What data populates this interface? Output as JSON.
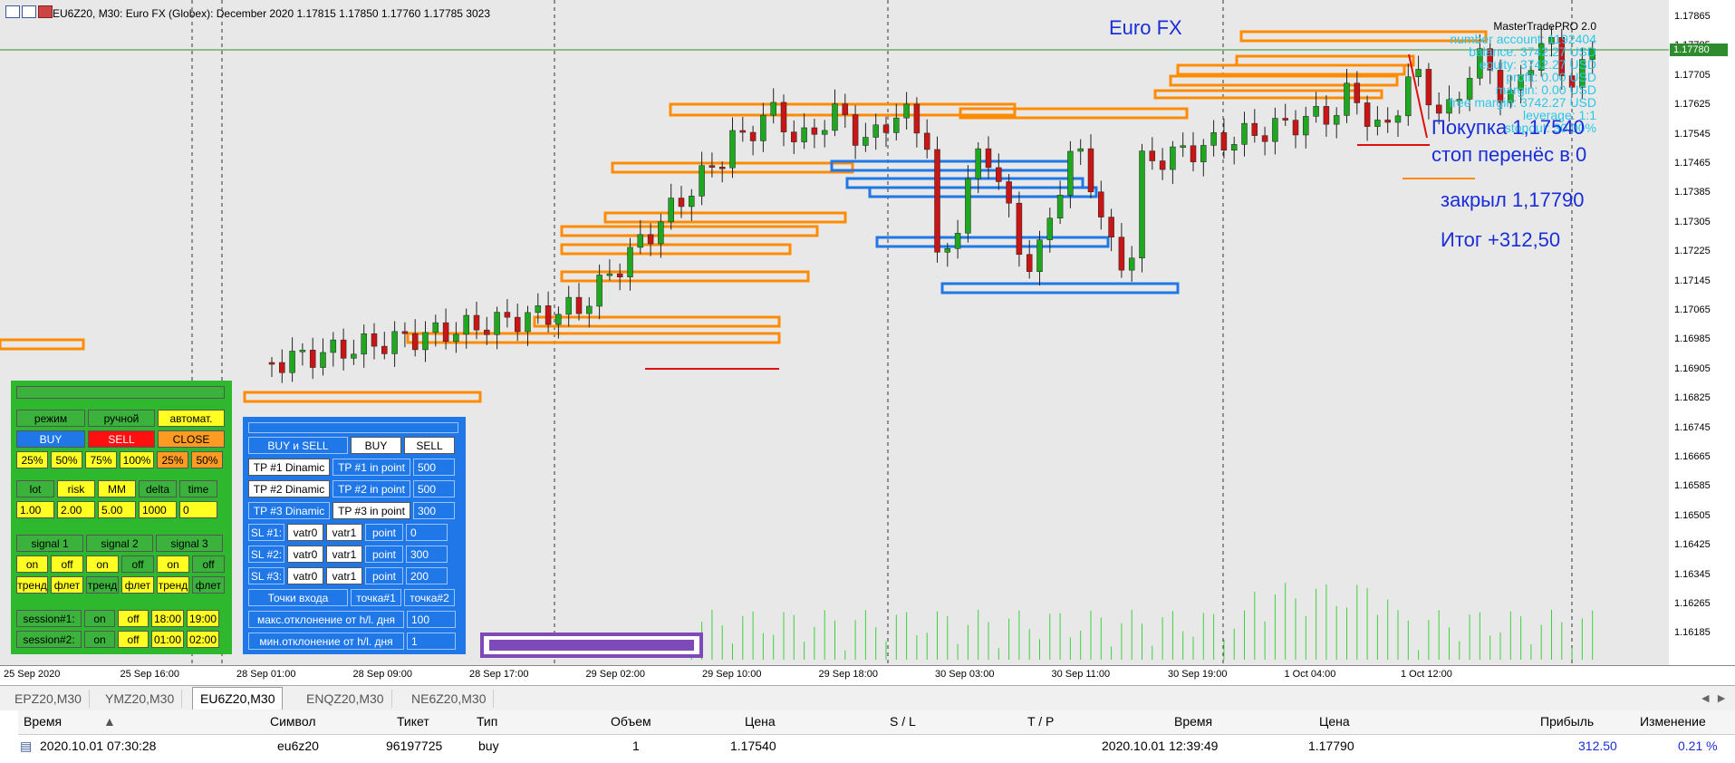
{
  "chart": {
    "title": "EU6Z20, M30:  Euro FX (Globex): December 2020  1.17815 1.17850 1.17760 1.17785  3023",
    "label_euro": "Euro FX",
    "current_price_tag": "1.17780",
    "price_ticks": [
      "1.17865",
      "1.17785",
      "1.17705",
      "1.17625",
      "1.17545",
      "1.17465",
      "1.17385",
      "1.17305",
      "1.17225",
      "1.17145",
      "1.17065",
      "1.16985",
      "1.16905",
      "1.16825",
      "1.16745",
      "1.16665",
      "1.16585",
      "1.16505",
      "1.16425",
      "1.16345",
      "1.16265",
      "1.16185"
    ],
    "time_ticks": [
      "25 Sep 2020",
      "25 Sep 16:00",
      "28 Sep 01:00",
      "28 Sep 09:00",
      "28 Sep 17:00",
      "29 Sep 02:00",
      "29 Sep 10:00",
      "29 Sep 18:00",
      "30 Sep 03:00",
      "30 Sep 11:00",
      "30 Sep 19:00",
      "1 Oct 04:00",
      "1 Oct 12:00"
    ],
    "colors": {
      "bull": "#1fa81f",
      "bear": "#c81515",
      "orange": "#ff8c00",
      "blue": "#1f77e8",
      "text_blue": "#1a2ed8",
      "cyan": "#2ac8e8"
    }
  },
  "account": {
    "brand": "MasterTradePRO 2.0",
    "lines": [
      "number account: 1192404",
      "balance: 3742.27 USD",
      "equity: 3742.27 USD",
      "profit: 0.00 USD",
      "margin: 0.00 USD",
      "free margin: 3742.27 USD",
      "leverage: 1:1",
      "stopout: 30.00%"
    ]
  },
  "annotations": {
    "buy": "Покупка 1,17540",
    "stop": "стоп перенёс в 0",
    "closed": "закрыл 1,17790",
    "result": "Итог +312,50"
  },
  "green_panel": {
    "mode": [
      "режим",
      "ручной",
      "автомат."
    ],
    "actions": [
      "BUY",
      "SELL",
      "CLOSE"
    ],
    "pct_left": [
      "25%",
      "50%",
      "75%",
      "100%"
    ],
    "pct_right": [
      "25%",
      "50%"
    ],
    "params_labels": [
      "lot",
      "risk",
      "MM",
      "delta",
      "time"
    ],
    "params_values": [
      "1.00",
      "2.00",
      "5.00",
      "1000",
      "0"
    ],
    "signals": [
      "signal 1",
      "signal 2",
      "signal 3"
    ],
    "on_off": [
      "on",
      "off",
      "on",
      "off",
      "on",
      "off"
    ],
    "trend_flat": [
      "тренд",
      "флет",
      "тренд",
      "флет",
      "тренд",
      "флет"
    ],
    "session1": {
      "label": "session#1:",
      "on": "on",
      "off": "off",
      "from": "18:00",
      "to": "19:00"
    },
    "session2": {
      "label": "session#2:",
      "on": "on",
      "off": "off",
      "from": "01:00",
      "to": "02:00"
    }
  },
  "blue_panel": {
    "top_buttons": [
      "BUY и SELL",
      "BUY",
      "SELL"
    ],
    "tp_rows": [
      {
        "a": "TP #1 Dinamic",
        "b": "TP #1 in point",
        "v": "500"
      },
      {
        "a": "TP #2 Dinamic",
        "b": "TP #2 in point",
        "v": "500"
      },
      {
        "a": "TP #3 Dinamic",
        "b": "TP #3 in point",
        "v": "300"
      }
    ],
    "sl_rows": [
      {
        "a": "SL #1:",
        "b": "vatr0",
        "c": "vatr1",
        "d": "point",
        "v": "0"
      },
      {
        "a": "SL #2:",
        "b": "vatr0",
        "c": "vatr1",
        "d": "point",
        "v": "300"
      },
      {
        "a": "SL #3:",
        "b": "vatr0",
        "c": "vatr1",
        "d": "point",
        "v": "200"
      }
    ],
    "entry": {
      "a": "Точки входа",
      "b": "точка#1",
      "c": "точка#2"
    },
    "max_dev": {
      "label": "макс.отклонение от h/l. дня",
      "v": "100"
    },
    "min_dev": {
      "label": "мин.отклонение от h/l. дня",
      "v": "1"
    }
  },
  "tabs": [
    "EPZ20,M30",
    "YMZ20,M30",
    "EU6Z20,M30",
    "ENQZ20,M30",
    "NE6Z20,M30"
  ],
  "active_tab": "EU6Z20,M30",
  "trades": {
    "headers": [
      "Время",
      "Символ",
      "Тикет",
      "Тип",
      "Объем",
      "Цена",
      "S / L",
      "T / P",
      "Время",
      "Цена",
      "Прибыль",
      "Изменение"
    ],
    "row": [
      "2020.10.01 07:30:28",
      "eu6z20",
      "96197725",
      "buy",
      "1",
      "1.17540",
      "",
      "",
      "2020.10.01 12:39:49",
      "1.17790",
      "312.50",
      "0.21 %"
    ]
  }
}
